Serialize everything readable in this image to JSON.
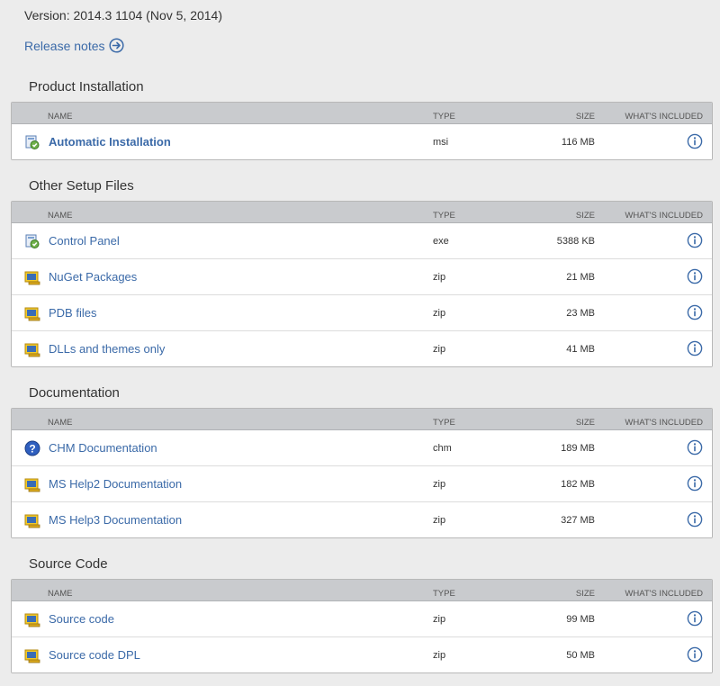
{
  "version_text": "Version: 2014.3 1104 (Nov 5, 2014)",
  "release_notes": "Release notes",
  "headers": {
    "name": "NAME",
    "type": "TYPE",
    "size": "SIZE",
    "included": "WHAT'S INCLUDED"
  },
  "colors": {
    "link": "#3b6aa8",
    "header_bg": "#c9cbce",
    "page_bg": "#ececec"
  },
  "sections": [
    {
      "title": "Product Installation",
      "rows": [
        {
          "icon": "installer-icon",
          "name": "Automatic Installation",
          "type": "msi",
          "size": "116 MB",
          "bold": true
        }
      ]
    },
    {
      "title": "Other Setup Files",
      "rows": [
        {
          "icon": "installer-icon",
          "name": "Control Panel",
          "type": "exe",
          "size": "5388 KB"
        },
        {
          "icon": "zip-icon",
          "name": "NuGet Packages",
          "type": "zip",
          "size": "21 MB"
        },
        {
          "icon": "zip-icon",
          "name": "PDB files",
          "type": "zip",
          "size": "23 MB"
        },
        {
          "icon": "zip-icon",
          "name": "DLLs and themes only",
          "type": "zip",
          "size": "41 MB"
        }
      ]
    },
    {
      "title": "Documentation",
      "rows": [
        {
          "icon": "help-icon",
          "name": "CHM Documentation",
          "type": "chm",
          "size": "189 MB"
        },
        {
          "icon": "zip-icon",
          "name": "MS Help2 Documentation",
          "type": "zip",
          "size": "182 MB"
        },
        {
          "icon": "zip-icon",
          "name": "MS Help3 Documentation",
          "type": "zip",
          "size": "327 MB"
        }
      ]
    },
    {
      "title": "Source Code",
      "rows": [
        {
          "icon": "zip-icon",
          "name": "Source code",
          "type": "zip",
          "size": "99 MB"
        },
        {
          "icon": "zip-icon",
          "name": "Source code DPL",
          "type": "zip",
          "size": "50 MB"
        }
      ]
    }
  ]
}
